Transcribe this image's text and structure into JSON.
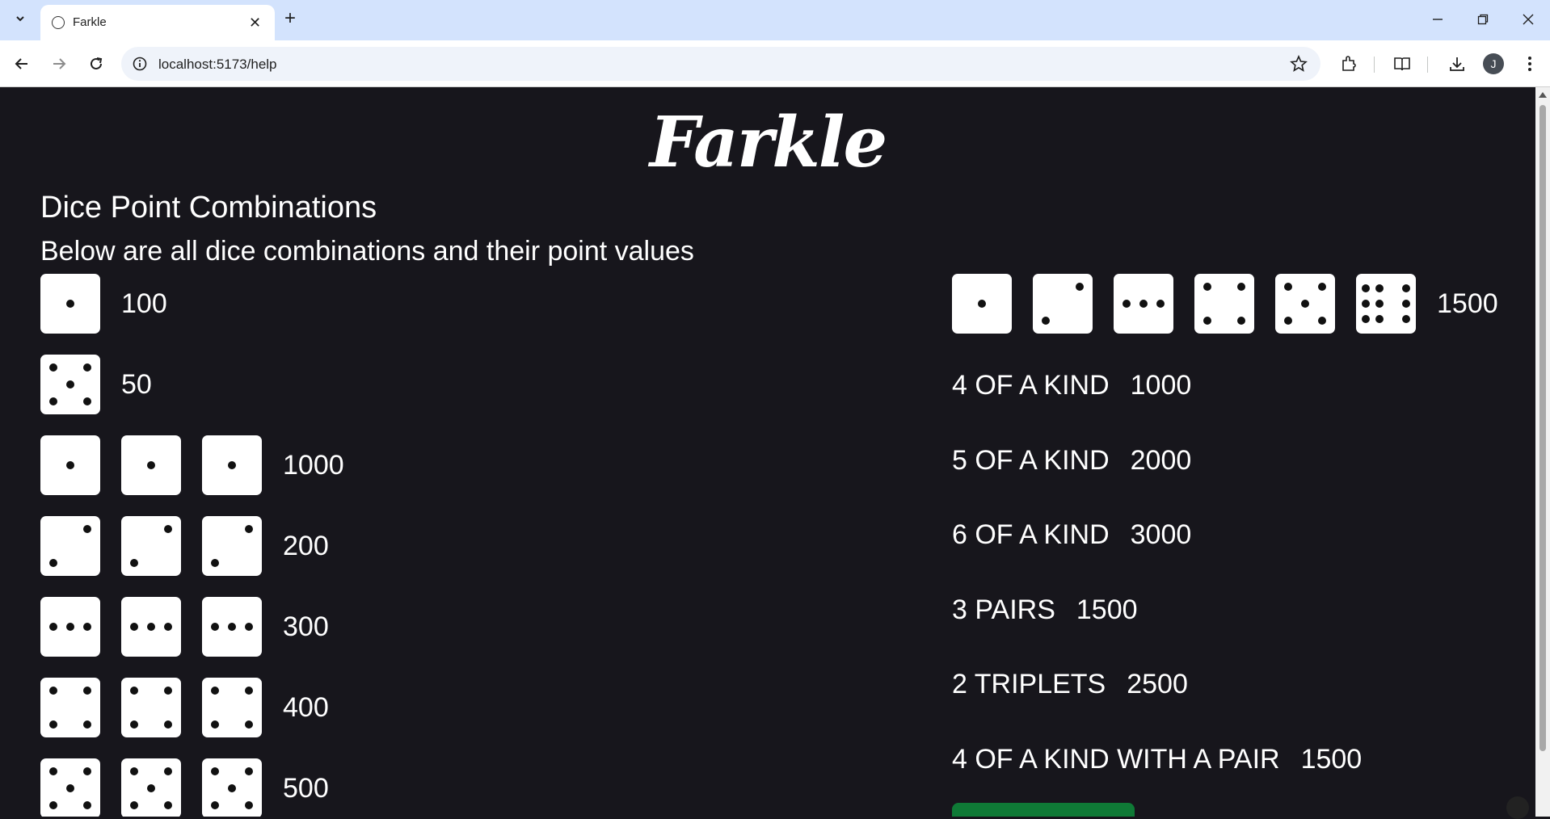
{
  "browser": {
    "tab_title": "Farkle",
    "url": "localhost:5173/help",
    "profile_initial": "J",
    "icons": [
      "tab-search-icon",
      "close-icon",
      "new-tab-icon",
      "minimize-icon",
      "restore-icon",
      "window-close-icon",
      "back-icon",
      "forward-icon",
      "reload-icon",
      "site-info-icon",
      "bookmark-star-icon",
      "extensions-icon",
      "reading-list-icon",
      "download-icon",
      "menu-icon"
    ]
  },
  "page": {
    "logo": "Farkle",
    "heading": "Dice Point Combinations",
    "subheading": "Below are all dice combinations and their point values",
    "combos": [
      {
        "faces": [
          1
        ],
        "points": "100"
      },
      {
        "faces": [
          5
        ],
        "points": "50"
      },
      {
        "faces": [
          1,
          1,
          1
        ],
        "points": "1000"
      },
      {
        "faces": [
          2,
          2,
          2
        ],
        "points": "200"
      },
      {
        "faces": [
          3,
          3,
          3
        ],
        "points": "300"
      },
      {
        "faces": [
          4,
          4,
          4
        ],
        "points": "400"
      },
      {
        "faces": [
          5,
          5,
          5
        ],
        "points": "500"
      }
    ],
    "straight": {
      "faces": [
        1,
        2,
        3,
        4,
        5,
        6
      ],
      "points": "1500"
    },
    "rules": [
      {
        "label": "4 OF A KIND",
        "points": "1000"
      },
      {
        "label": "5 OF A KIND",
        "points": "2000"
      },
      {
        "label": "6 OF A KIND",
        "points": "3000"
      },
      {
        "label": "3 PAIRS",
        "points": "1500"
      },
      {
        "label": "2 TRIPLETS",
        "points": "2500"
      },
      {
        "label": "4 OF A KIND WITH A PAIR",
        "points": "1500"
      }
    ],
    "colors": {
      "background": "#17161c",
      "text": "#ffffff",
      "die": "#ffffff",
      "pip": "#111111",
      "button": "#0f7a36"
    }
  }
}
